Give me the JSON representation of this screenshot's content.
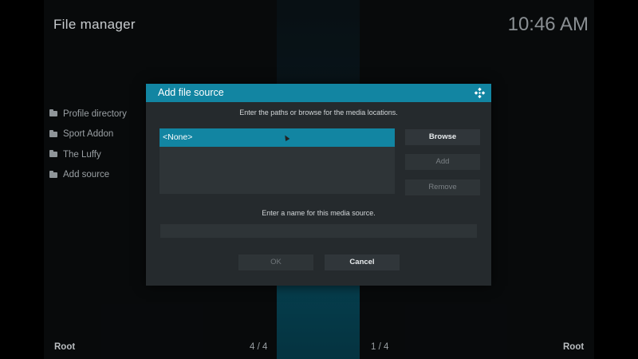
{
  "app": {
    "title": "File manager",
    "clock": "10:46 AM"
  },
  "sidebar": {
    "items": [
      {
        "label": "Profile directory"
      },
      {
        "label": "Sport Addon"
      },
      {
        "label": "The Luffy"
      },
      {
        "label": "Add source"
      }
    ]
  },
  "footer": {
    "left_root": "Root",
    "left_count": "4 / 4",
    "right_count": "1 / 4",
    "right_root": "Root"
  },
  "dialog": {
    "title": "Add file source",
    "instruction_paths": "Enter the paths or browse for the media locations.",
    "paths": [
      {
        "label": "<None>"
      }
    ],
    "buttons": {
      "browse": "Browse",
      "add": "Add",
      "remove": "Remove",
      "ok": "OK",
      "cancel": "Cancel"
    },
    "instruction_name": "Enter a name for this media source.",
    "name_value": ""
  },
  "colors": {
    "accent": "#1285a2",
    "dialog_bg": "#252a2d",
    "background": "#0d1012"
  },
  "icons": {
    "folder": "folder-icon",
    "kodi": "kodi-logo-icon"
  }
}
